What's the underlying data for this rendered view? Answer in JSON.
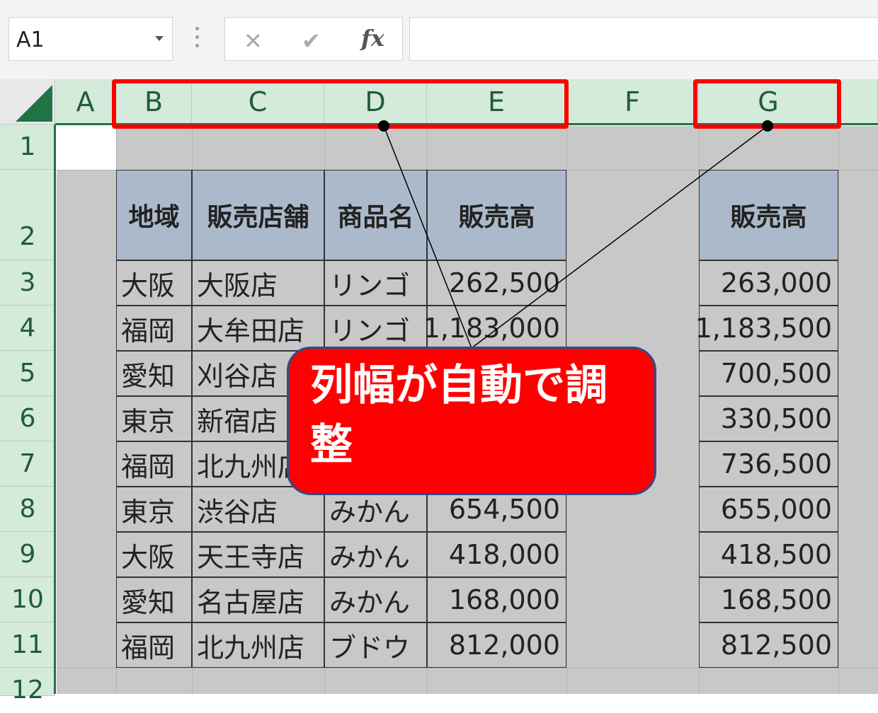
{
  "name_box": {
    "value": "A1"
  },
  "formula_bar": {
    "cancel_icon": "cross-icon",
    "enter_icon": "check-icon",
    "function_label": "fx",
    "value": ""
  },
  "columns": [
    "A",
    "B",
    "C",
    "D",
    "E",
    "F",
    "G"
  ],
  "rows": [
    "1",
    "2",
    "3",
    "4",
    "5",
    "6",
    "7",
    "8",
    "9",
    "10",
    "11",
    "12"
  ],
  "table1": {
    "headers": [
      "地域",
      "販売店舗",
      "商品名",
      "販売高"
    ],
    "rows": [
      [
        "大阪",
        "大阪店",
        "リンゴ",
        "262,500"
      ],
      [
        "福岡",
        "大牟田店",
        "リンゴ",
        "1,183,000"
      ],
      [
        "愛知",
        "刈谷店",
        "",
        ""
      ],
      [
        "東京",
        "新宿店",
        "",
        ""
      ],
      [
        "福岡",
        "北九州店",
        "",
        ""
      ],
      [
        "東京",
        "渋谷店",
        "みかん",
        "654,500"
      ],
      [
        "大阪",
        "天王寺店",
        "みかん",
        "418,000"
      ],
      [
        "愛知",
        "名古屋店",
        "みかん",
        "168,000"
      ],
      [
        "福岡",
        "北九州店",
        "ブドウ",
        "812,000"
      ]
    ]
  },
  "table2": {
    "header": "販売高",
    "values": [
      "263,000",
      "1,183,500",
      "700,500",
      "330,500",
      "736,500",
      "655,000",
      "418,500",
      "168,500",
      "812,500"
    ]
  },
  "callout": {
    "text": "列幅が自動で調整"
  },
  "colors": {
    "excel_green": "#217346",
    "header_fill": "#acb9ca",
    "highlight_red": "#ff0000"
  }
}
